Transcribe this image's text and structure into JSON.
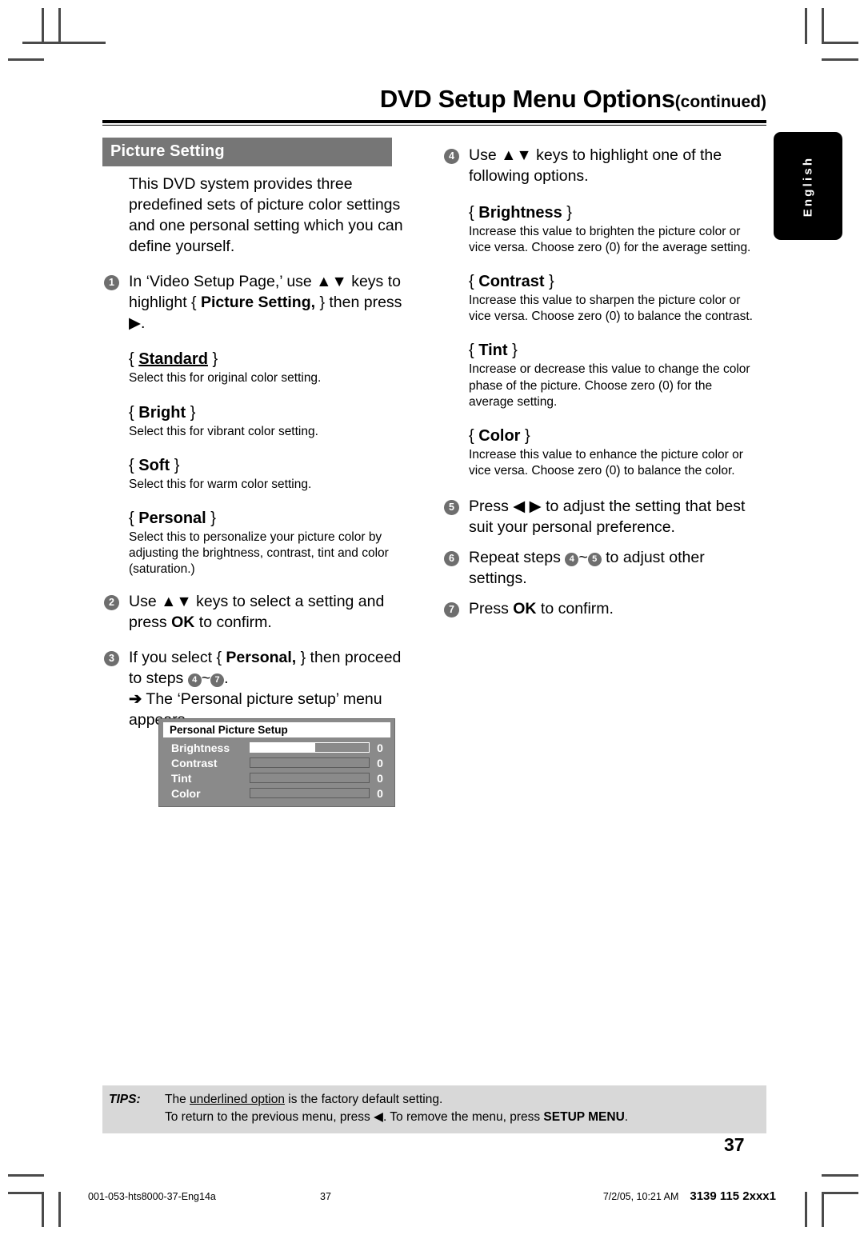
{
  "header": {
    "title": "DVD Setup Menu Options",
    "continued": "(continued)"
  },
  "sidebar": {
    "language_tab": "English"
  },
  "left_column": {
    "section_title": "Picture Setting",
    "intro": "This DVD system provides three predefined sets of picture color settings and one personal setting which you can define yourself.",
    "step1": {
      "num": "1",
      "text_a": "In ‘Video Setup Page,’ use ▲▼ keys to highlight { ",
      "bold": "Picture Setting,",
      "text_b": " } then press ▶."
    },
    "options": [
      {
        "open": "{ ",
        "name": "Standard",
        "close": " }",
        "underlined": true,
        "desc": "Select this for original color setting."
      },
      {
        "open": "{ ",
        "name": "Bright",
        "close": " }",
        "underlined": false,
        "desc": "Select this for vibrant color setting."
      },
      {
        "open": "{ ",
        "name": "Soft",
        "close": " }",
        "underlined": false,
        "desc": "Select this for warm color setting."
      },
      {
        "open": "{ ",
        "name": "Personal",
        "close": " }",
        "underlined": false,
        "desc": "Select this to personalize your picture color by adjusting the brightness, contrast, tint and color (saturation.)"
      }
    ],
    "step2": {
      "num": "2",
      "text_a": "Use ▲▼ keys to select a setting and press ",
      "bold": "OK",
      "text_b": " to confirm."
    },
    "step3": {
      "num": "3",
      "text_a": "If you select { ",
      "bold": "Personal,",
      "text_b": " } then proceed to steps ",
      "ref_from": "4",
      "tilde": "~",
      "ref_to": "7",
      "period": ".",
      "arrow": "➔",
      "result": "The ‘Personal picture setup’ menu appears."
    }
  },
  "osd_menu": {
    "title": "Personal Picture Setup",
    "rows": [
      {
        "label": "Brightness",
        "value": "0",
        "fill_percent": 55,
        "highlighted": true
      },
      {
        "label": "Contrast",
        "value": "0",
        "fill_percent": 0,
        "highlighted": false
      },
      {
        "label": "Tint",
        "value": "0",
        "fill_percent": 0,
        "highlighted": false
      },
      {
        "label": "Color",
        "value": "0",
        "fill_percent": 0,
        "highlighted": false
      }
    ]
  },
  "right_column": {
    "step4": {
      "num": "4",
      "text": "Use ▲▼ keys to highlight one of the following options."
    },
    "options": [
      {
        "open": "{ ",
        "name": "Brightness",
        "close": " }",
        "desc": "Increase this value to brighten the picture color or vice versa. Choose zero (0) for the average setting."
      },
      {
        "open": "{ ",
        "name": "Contrast",
        "close": " }",
        "desc": "Increase this value to sharpen the picture color or vice versa.  Choose zero (0) to balance the contrast."
      },
      {
        "open": "{ ",
        "name": "Tint",
        "close": " }",
        "desc": "Increase or decrease this value to change the color phase of the picture.  Choose zero (0) for the average setting."
      },
      {
        "open": "{ ",
        "name": "Color",
        "close": " }",
        "desc": "Increase this value to enhance the picture color or vice versa. Choose zero (0) to balance the color."
      }
    ],
    "step5": {
      "num": "5",
      "text": "Press ◀ ▶ to adjust the setting that best suit your personal preference."
    },
    "step6": {
      "num": "6",
      "text_a": "Repeat steps ",
      "ref_from": "4",
      "tilde": "~",
      "ref_to": "5",
      "text_b": " to adjust other settings."
    },
    "step7": {
      "num": "7",
      "text_a": "Press ",
      "bold": "OK",
      "text_b": " to confirm."
    }
  },
  "tips": {
    "label": "TIPS:",
    "line1_a": "The ",
    "line1_underlined": "underlined option",
    "line1_b": " is the factory default setting.",
    "line2_a": "To return to the previous menu, press ◀. To remove the menu, press ",
    "line2_bold": "SETUP MENU",
    "line2_c": "."
  },
  "page_number": "37",
  "footer": {
    "file": "001-053-hts8000-37-Eng14a",
    "page": "37",
    "date": "7/2/05, 10:21 AM",
    "code": "3139 115 2xxx1"
  }
}
